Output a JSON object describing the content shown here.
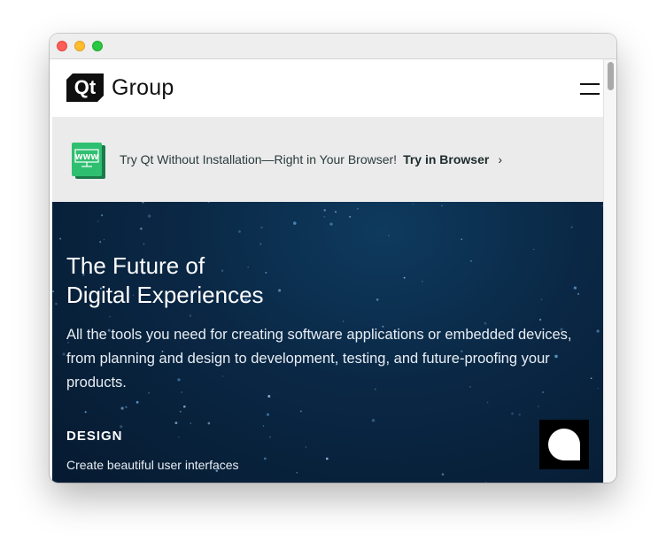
{
  "header": {
    "logo_mark": "Qt",
    "logo_word": "Group",
    "menu_icon": "hamburger-menu-icon"
  },
  "banner": {
    "icon": "www-monitor-icon",
    "icon_text": "WWW",
    "text": "Try Qt Without Installation—Right in Your Browser!",
    "link_label": "Try in Browser",
    "chevron": "›"
  },
  "hero": {
    "title_line1": "The Future of",
    "title_line2": "Digital Experiences",
    "description": "All the tools you need for creating software applications or embedded devices, from planning and design to development, testing, and future-proofing your products.",
    "section_label": "DESIGN",
    "section_desc": "Create beautiful user interfaces",
    "chat_icon": "chat-bubble-icon"
  },
  "colors": {
    "hero_bg": "#0a2744",
    "banner_bg": "#ebebeb",
    "icon_green": "#2fbf71",
    "logo_black": "#0f0f0f"
  }
}
